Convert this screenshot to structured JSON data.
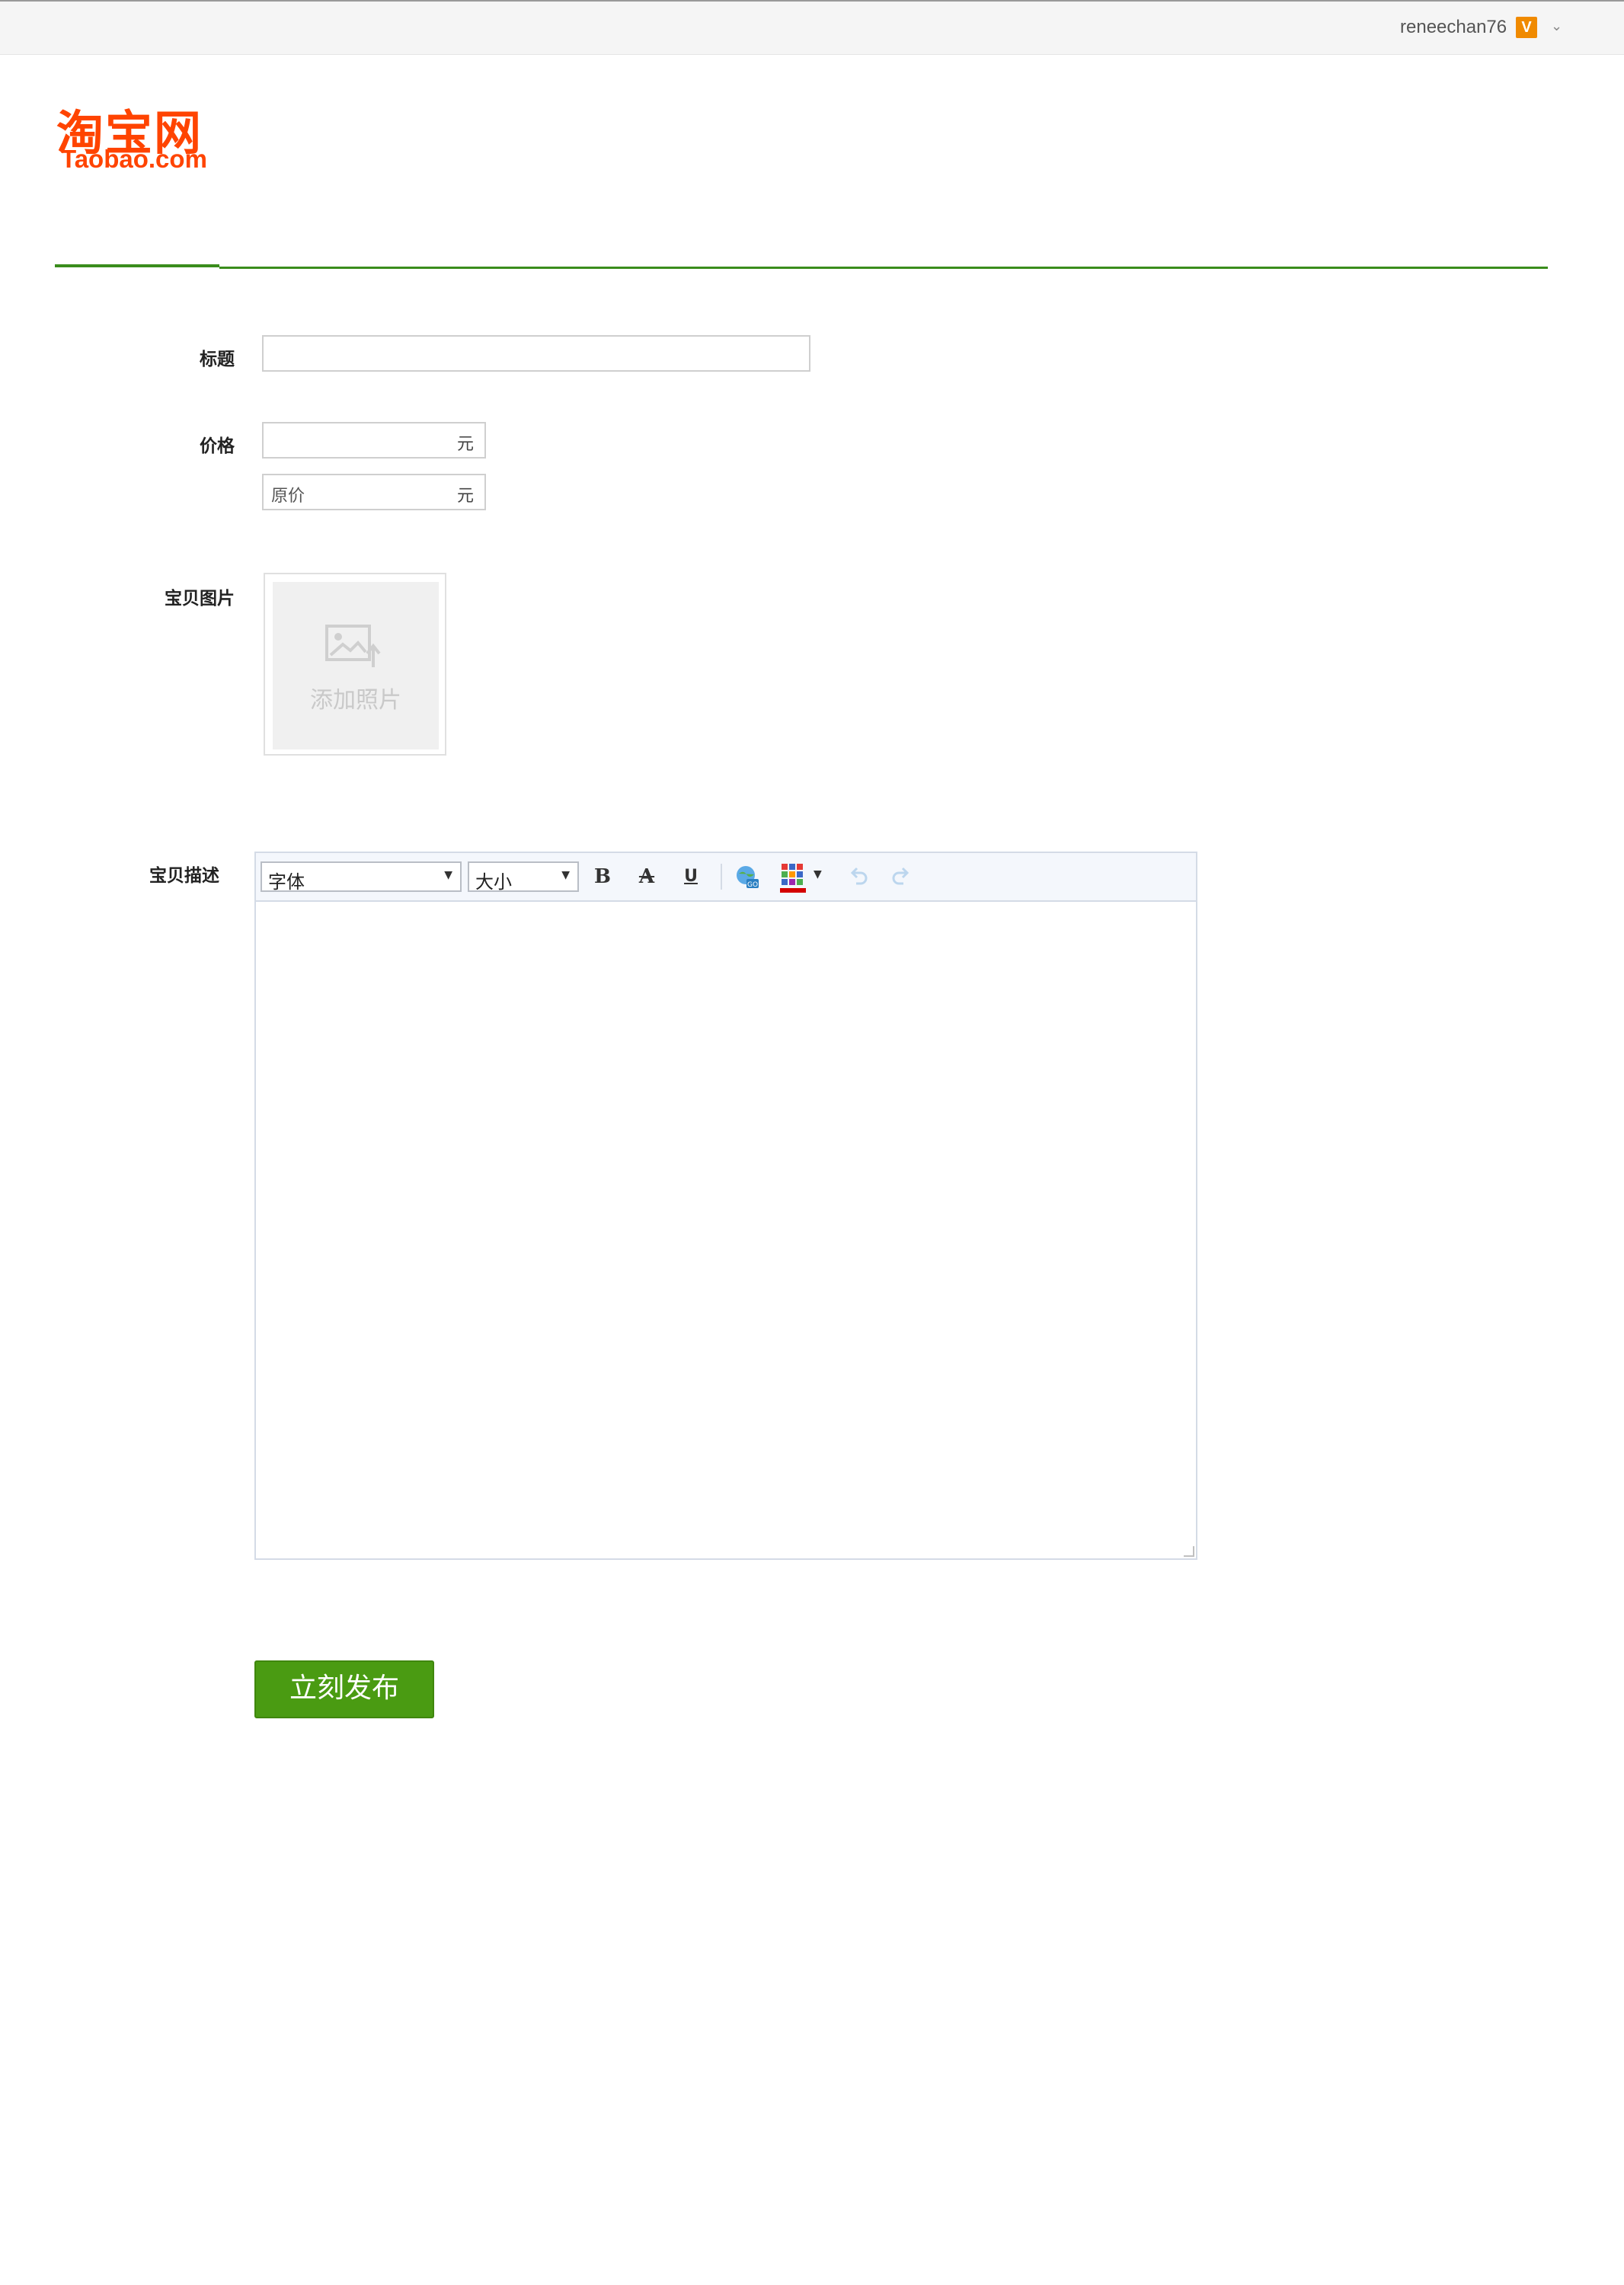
{
  "topbar": {
    "username": "reneechan76",
    "vip_badge": "V",
    "dropdown_icon": "chevron-down-icon"
  },
  "logo": {
    "cn": "淘宝网",
    "en": "Taobao.com"
  },
  "form": {
    "title_label": "标题",
    "title_value": "",
    "price_label": "价格",
    "price_value": "",
    "price_unit": "元",
    "original_price_placeholder": "原价",
    "original_price_unit": "元",
    "images_label": "宝贝图片",
    "add_photo_text": "添加照片",
    "description_label": "宝贝描述",
    "editor": {
      "font_select": "字体",
      "size_select": "大小",
      "bold": "B",
      "strikethrough": "A",
      "underline": "U",
      "content": ""
    },
    "publish_button": "立刻发布"
  },
  "colors": {
    "brand": "#ff4400",
    "accent_green": "#4a9b12",
    "rule_green": "#3a8c1c"
  }
}
